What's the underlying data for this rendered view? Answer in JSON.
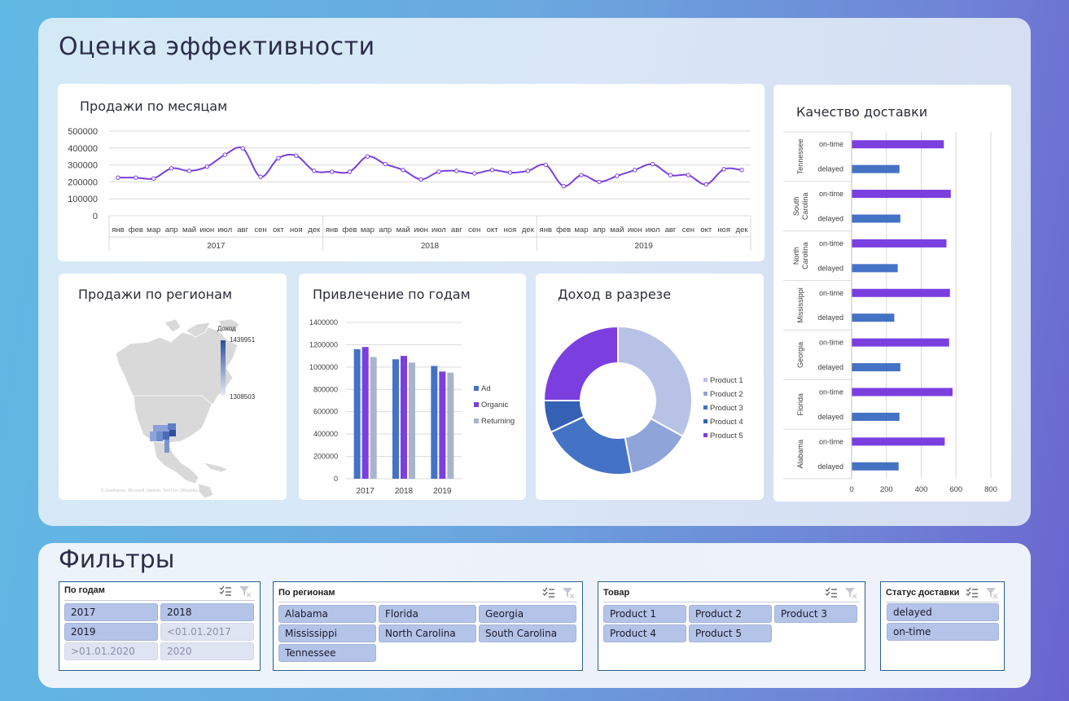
{
  "titles": {
    "main": "Оценка эффективности",
    "filters": "Фильтры"
  },
  "cards": {
    "monthly": "Продажи по месяцам",
    "regions": "Продажи по регионам",
    "attraction": "Привлечение по годам",
    "income": "Доход в разрезе",
    "delivery": "Качество доставки"
  },
  "map": {
    "legend_title": "Доход",
    "legend_max": "1439951",
    "legend_min": "1308503",
    "credit": "© GeoNames, Microsoft, Navinfo, TomTom, Wikipedia"
  },
  "chart_data": [
    {
      "type": "line",
      "title": "Продажи по месяцам",
      "y_ticks": [
        "500000",
        "400000",
        "300000",
        "200000",
        "100000",
        "0"
      ],
      "ylim": [
        0,
        500000
      ],
      "years": [
        "2017",
        "2018",
        "2019"
      ],
      "months": [
        "янв",
        "фев",
        "мар",
        "апр",
        "май",
        "июн",
        "июл",
        "авг",
        "сен",
        "окт",
        "ноя",
        "дек"
      ],
      "values": [
        225000,
        225000,
        220000,
        280000,
        265000,
        290000,
        360000,
        398000,
        230000,
        340000,
        355000,
        265000,
        260000,
        260000,
        350000,
        305000,
        270000,
        215000,
        260000,
        265000,
        250000,
        270000,
        255000,
        265000,
        300000,
        175000,
        240000,
        200000,
        235000,
        270000,
        305000,
        240000,
        240000,
        185000,
        275000,
        270000
      ],
      "color": "#7b3fe0"
    },
    {
      "type": "bar",
      "title": "Привлечение по годам",
      "categories": [
        "2017",
        "2018",
        "2019"
      ],
      "y_ticks": [
        "1400000",
        "1200000",
        "1000000",
        "800000",
        "600000",
        "400000",
        "200000",
        "0"
      ],
      "ylim": [
        0,
        1400000
      ],
      "series": [
        {
          "name": "Ad",
          "values": [
            1160000,
            1070000,
            1010000
          ],
          "color": "#4472c4"
        },
        {
          "name": "Organic",
          "values": [
            1180000,
            1100000,
            960000
          ],
          "color": "#7b3fe0"
        },
        {
          "name": "Returning",
          "values": [
            1090000,
            1040000,
            950000
          ],
          "color": "#a9b4cc"
        }
      ]
    },
    {
      "type": "pie",
      "title": "Доход в разрезе",
      "labels": [
        "Product 1",
        "Product 2",
        "Product 3",
        "Product 4",
        "Product 5"
      ],
      "values": [
        33,
        14,
        21,
        7,
        25
      ],
      "colors": [
        "#b8c2e6",
        "#8fa4d8",
        "#4472c4",
        "#3461b4",
        "#7b3fe0"
      ]
    },
    {
      "type": "bar",
      "title": "Качество доставки",
      "orientation": "horizontal",
      "x_ticks": [
        "0",
        "200",
        "400",
        "600",
        "800"
      ],
      "xlim": [
        0,
        800
      ],
      "groups": [
        {
          "name": "Tennessee",
          "on_time": 530,
          "delayed": 275
        },
        {
          "name": "South Carolina",
          "on_time": 570,
          "delayed": 280
        },
        {
          "name": "North Carolina",
          "on_time": 545,
          "delayed": 265
        },
        {
          "name": "Mississippi",
          "on_time": 565,
          "delayed": 245
        },
        {
          "name": "Georgia",
          "on_time": 560,
          "delayed": 280
        },
        {
          "name": "Florida",
          "on_time": 580,
          "delayed": 275
        },
        {
          "name": "Alabama",
          "on_time": 535,
          "delayed": 270
        }
      ],
      "row_labels": [
        "on-time",
        "delayed"
      ],
      "colors": {
        "on_time": "#7b3fe0",
        "delayed": "#4472c4"
      }
    }
  ],
  "slicers": {
    "years": {
      "title": "По годам",
      "items": [
        "2017",
        "2018",
        "2019",
        "<01.01.2017",
        ">01.01.2020",
        "2020"
      ]
    },
    "regions": {
      "title": "По регионам",
      "items": [
        "Alabama",
        "Florida",
        "Georgia",
        "Mississippi",
        "North Carolina",
        "South Carolina",
        "Tennessee"
      ]
    },
    "product": {
      "title": "Товар",
      "items": [
        "Product 1",
        "Product 2",
        "Product 3",
        "Product 4",
        "Product 5"
      ]
    },
    "status": {
      "title": "Статус доставки",
      "items": [
        "delayed",
        "on-time"
      ]
    }
  },
  "icons": {
    "multiselect": "multiselect-icon",
    "clear_filter": "clear-filter-icon"
  }
}
